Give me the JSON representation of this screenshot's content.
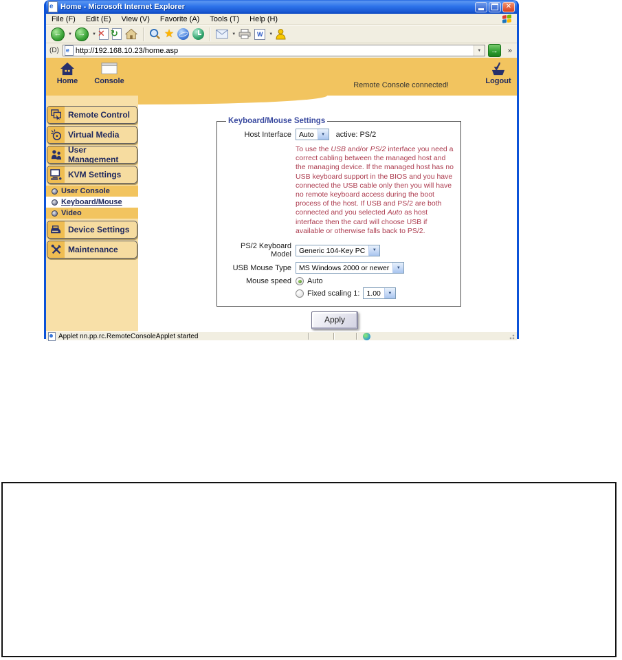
{
  "browser": {
    "title": "Home - Microsoft Internet Explorer",
    "menu": [
      "File (F)",
      "Edit (E)",
      "View (V)",
      "Favorite (A)",
      "Tools (T)",
      "Help (H)"
    ],
    "toolbar_buttons": [
      "back",
      "forward",
      "stop",
      "refresh",
      "home",
      "search",
      "favorites",
      "media",
      "history",
      "mail",
      "print",
      "edit",
      "messenger"
    ],
    "address_label": "(D)",
    "url": "http://192.168.10.23/home.asp",
    "go_glyph": "→",
    "links_chevron": "»",
    "status_text": "Applet nn.pp.rc.RemoteConsoleApplet started"
  },
  "header": {
    "home": "Home",
    "console": "Console",
    "connection_status": "Remote Console connected!",
    "logout": "Logout"
  },
  "sidebar": {
    "items": [
      {
        "label": "Remote Control"
      },
      {
        "label": "Virtual Media"
      },
      {
        "label": "User Management"
      },
      {
        "label": "KVM Settings"
      },
      {
        "label": "Device Settings"
      },
      {
        "label": "Maintenance"
      }
    ],
    "kvm_submenu": [
      {
        "label": "User Console",
        "selected": false
      },
      {
        "label": "Keyboard/Mouse",
        "selected": true
      },
      {
        "label": "Video",
        "selected": false
      }
    ]
  },
  "settings": {
    "legend": "Keyboard/Mouse Settings",
    "host_interface_label": "Host Interface",
    "host_interface_value": "Auto",
    "active_text": "active: PS/2",
    "note_segments": [
      {
        "t": "To use the "
      },
      {
        "t": "USB",
        "i": true
      },
      {
        "t": " and/or "
      },
      {
        "t": "PS/2",
        "i": true
      },
      {
        "t": " interface you need a correct cabling between the managed host and the managing device. If the managed host has no USB keyboard support in the BIOS and you have connected the USB cable only then you will have no remote keyboard access during the boot process of the host. If USB and PS/2 are both connected and you selected "
      },
      {
        "t": "Auto",
        "i": true
      },
      {
        "t": " as host interface then the card will choose USB if available or otherwise falls back to PS/2."
      }
    ],
    "ps2_label": "PS/2 Keyboard Model",
    "ps2_value": "Generic 104-Key PC",
    "usb_label": "USB Mouse Type",
    "usb_value": "MS Windows 2000 or newer",
    "mouse_speed_label": "Mouse speed",
    "mouse_auto_label": "Auto",
    "mouse_fixed_label": "Fixed scaling 1:",
    "mouse_fixed_value": "1.00",
    "mouse_speed_selected": "auto",
    "apply": "Apply"
  },
  "colors": {
    "header_orange": "#F2C45F",
    "sidebar_peach": "#F8E0A8",
    "icon_cell_orange": "#EFBD52",
    "navy_text": "#20295E",
    "legend_blue": "#3B4BA0",
    "note_red": "#AC3B4E",
    "titlebar_blue": "#2464DF",
    "go_green": "#2E9E2E"
  }
}
